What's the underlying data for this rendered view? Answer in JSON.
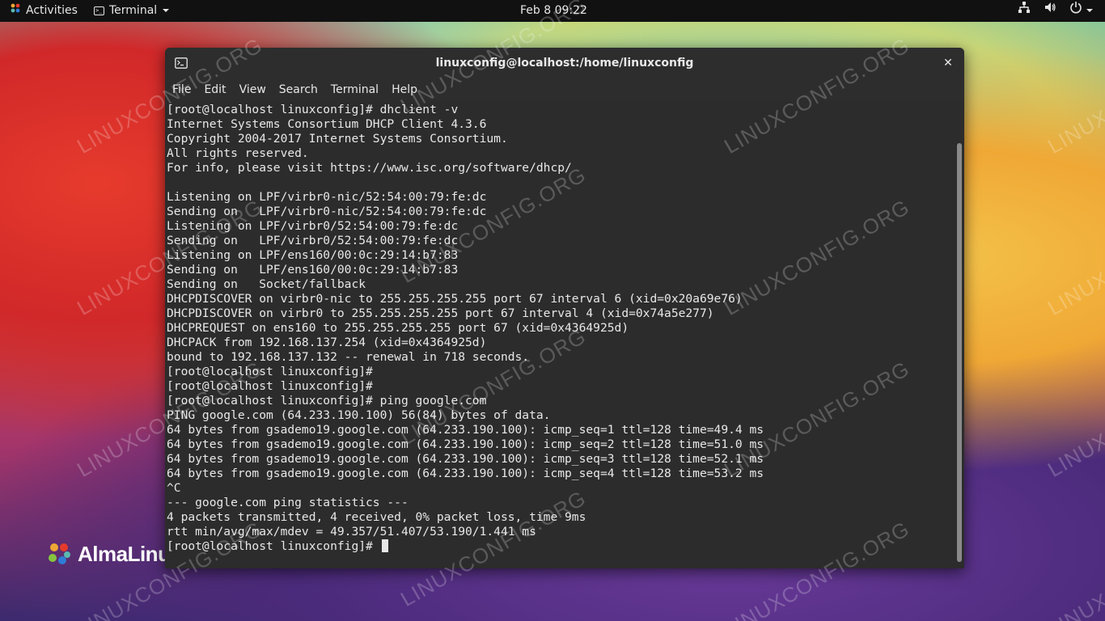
{
  "topbar": {
    "activities_label": "Activities",
    "app_menu_label": "Terminal",
    "clock": "Feb 8  09:22",
    "icons": [
      "network-icon",
      "volume-icon",
      "power-icon",
      "chevron-down-icon"
    ]
  },
  "window": {
    "title": "linuxconfig@localhost:/home/linuxconfig",
    "close_glyph": "✕",
    "menu": [
      "File",
      "Edit",
      "View",
      "Search",
      "Terminal",
      "Help"
    ]
  },
  "terminal": {
    "lines": [
      "[root@localhost linuxconfig]# dhclient -v",
      "Internet Systems Consortium DHCP Client 4.3.6",
      "Copyright 2004-2017 Internet Systems Consortium.",
      "All rights reserved.",
      "For info, please visit https://www.isc.org/software/dhcp/",
      "",
      "Listening on LPF/virbr0-nic/52:54:00:79:fe:dc",
      "Sending on   LPF/virbr0-nic/52:54:00:79:fe:dc",
      "Listening on LPF/virbr0/52:54:00:79:fe:dc",
      "Sending on   LPF/virbr0/52:54:00:79:fe:dc",
      "Listening on LPF/ens160/00:0c:29:14:b7:83",
      "Sending on   LPF/ens160/00:0c:29:14:b7:83",
      "Sending on   Socket/fallback",
      "DHCPDISCOVER on virbr0-nic to 255.255.255.255 port 67 interval 6 (xid=0x20a69e76)",
      "DHCPDISCOVER on virbr0 to 255.255.255.255 port 67 interval 4 (xid=0x74a5e277)",
      "DHCPREQUEST on ens160 to 255.255.255.255 port 67 (xid=0x4364925d)",
      "DHCPACK from 192.168.137.254 (xid=0x4364925d)",
      "bound to 192.168.137.132 -- renewal in 718 seconds.",
      "[root@localhost linuxconfig]#",
      "[root@localhost linuxconfig]#",
      "[root@localhost linuxconfig]# ping google.com",
      "PING google.com (64.233.190.100) 56(84) bytes of data.",
      "64 bytes from gsademo19.google.com (64.233.190.100): icmp_seq=1 ttl=128 time=49.4 ms",
      "64 bytes from gsademo19.google.com (64.233.190.100): icmp_seq=2 ttl=128 time=51.0 ms",
      "64 bytes from gsademo19.google.com (64.233.190.100): icmp_seq=3 ttl=128 time=52.1 ms",
      "64 bytes from gsademo19.google.com (64.233.190.100): icmp_seq=4 ttl=128 time=53.2 ms",
      "^C",
      "--- google.com ping statistics ---",
      "4 packets transmitted, 4 received, 0% packet loss, time 9ms",
      "rtt min/avg/max/mdev = 49.357/51.407/53.190/1.441 ms"
    ],
    "prompt": "[root@localhost linuxconfig]# "
  },
  "desktop": {
    "logo_text": "AlmaLinux",
    "watermark": "LINUXCONFIG.ORG"
  },
  "colors": {
    "terminal_bg": "#2c2c2c",
    "terminal_fg": "#e8e8e8",
    "topbar_bg": "#111111"
  }
}
